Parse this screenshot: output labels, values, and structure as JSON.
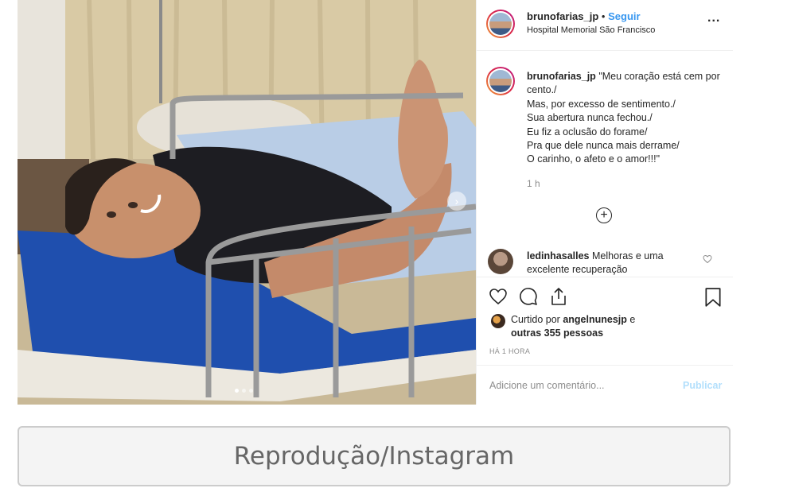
{
  "post": {
    "photo_alt": "Man smiling lying on a hospital bed",
    "carousel_count": 3,
    "carousel_active": 1
  },
  "header": {
    "username": "brunofarias_jp",
    "separator": "•",
    "follow_label": "Seguir",
    "location": "Hospital Memorial São Francisco",
    "more_label": "..."
  },
  "caption": {
    "username": "brunofarias_jp",
    "lines": [
      "\"Meu coração está cem por cento./",
      "Mas, por excesso de sentimento./",
      "Sua abertura nunca fechou./",
      "Eu fiz a oclusão do forame/",
      "Pra que dele nunca mais derrame/",
      "O carinho, o afeto e o amor!!!\""
    ],
    "time": "1 h"
  },
  "load_more_label": "+",
  "comments": [
    {
      "username": "ledinhasalles",
      "text": "Melhoras e uma excelente recuperação"
    }
  ],
  "likes": {
    "prefix": "Curtido por ",
    "user": "angelnunesjp",
    "suffix": " e",
    "others": "outras 355 pessoas"
  },
  "time_ago": "HÁ 1 HORA",
  "add_comment": {
    "placeholder": "Adicione um comentário...",
    "publish_label": "Publicar"
  },
  "credit": "Reprodução/Instagram",
  "colors": {
    "link": "#3897f0",
    "publish_disabled": "#b2dffc",
    "muted": "#8e8e8e",
    "text": "#262626"
  },
  "icons": [
    "heart-icon",
    "comment-icon",
    "share-icon",
    "bookmark-icon",
    "more-options-icon",
    "add-circle-icon",
    "chevron-right-icon"
  ]
}
